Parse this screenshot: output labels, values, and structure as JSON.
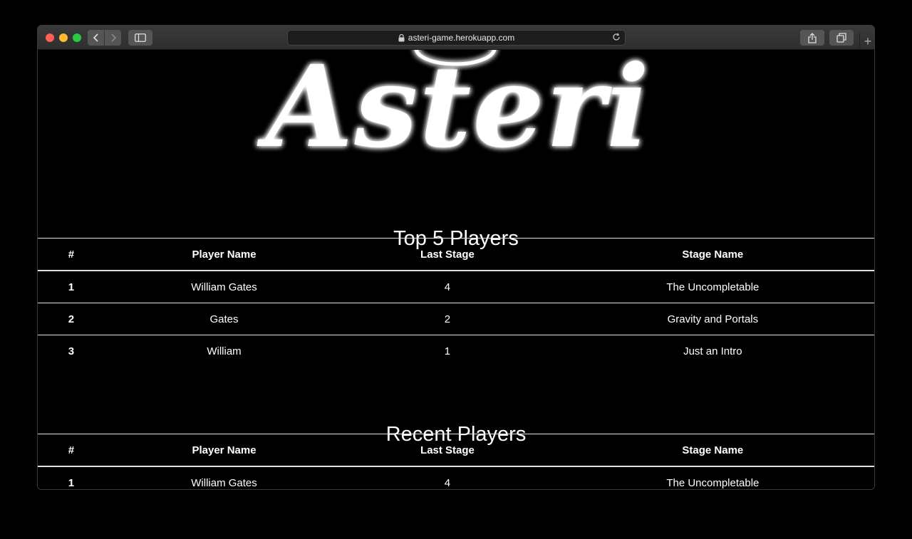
{
  "browser": {
    "url": "asteri-game.herokuapp.com"
  },
  "page": {
    "logo_text": "Asteri",
    "top_players": {
      "title": "Top 5 Players",
      "headers": [
        "#",
        "Player Name",
        "Last Stage",
        "Stage Name"
      ],
      "rows": [
        {
          "rank": "1",
          "name": "William Gates",
          "stage": "4",
          "stage_name": "The Uncompletable"
        },
        {
          "rank": "2",
          "name": "Gates",
          "stage": "2",
          "stage_name": "Gravity and Portals"
        },
        {
          "rank": "3",
          "name": "William",
          "stage": "1",
          "stage_name": "Just an Intro"
        }
      ]
    },
    "recent_players": {
      "title": "Recent Players",
      "headers": [
        "#",
        "Player Name",
        "Last Stage",
        "Stage Name"
      ],
      "rows": [
        {
          "rank": "1",
          "name": "William Gates",
          "stage": "4",
          "stage_name": "The Uncompletable"
        }
      ]
    }
  },
  "colors": {
    "background": "#000000",
    "text": "#ffffff",
    "table_border": "#dee2e6",
    "logo_glow": "#ffffff"
  },
  "icons": [
    "lock-icon",
    "reload-icon",
    "back-icon",
    "forward-icon",
    "sidebar-icon",
    "share-icon",
    "tabs-icon",
    "new-tab-icon"
  ]
}
